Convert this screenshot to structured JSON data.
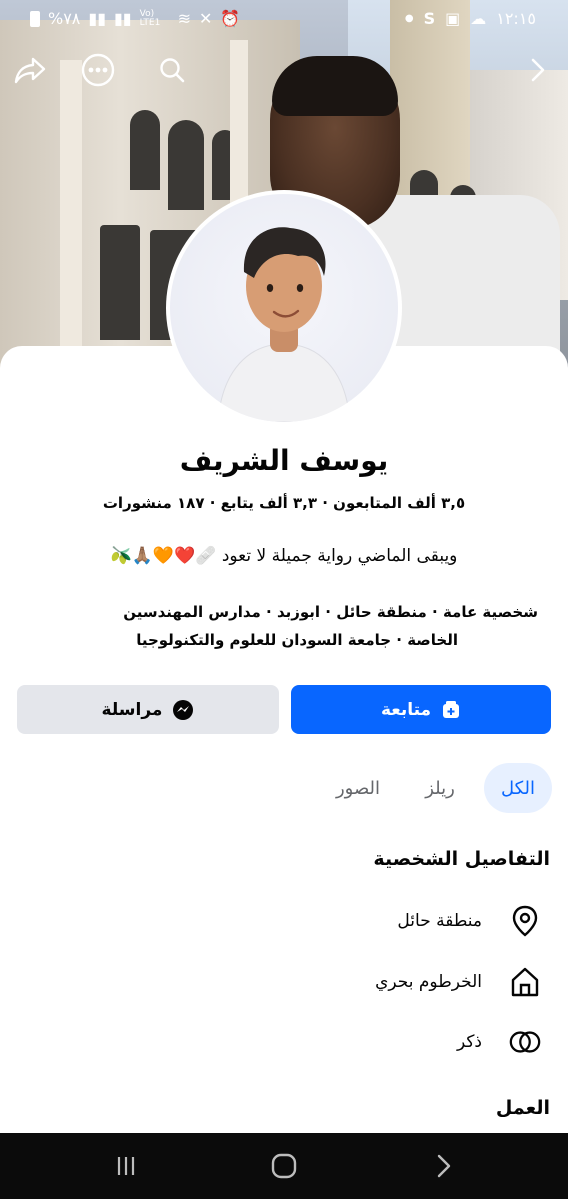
{
  "status_bar": {
    "time": "١٢:١٥",
    "battery": "%٧٨",
    "network": "Vo) LTE1"
  },
  "profile": {
    "name": "يوسف الشريف",
    "stats": "٣,٥ ألف المتابعون · ٣,٣ ألف يتابع · ١٨٧ منشورات",
    "bio": "ويبقى الماضي رواية جميلة لا تعود 🩹❤️🧡🙏🏽🫒",
    "meta_line1": "شخصية عامة · منطقة حائل · ابوزبد · مدارس المهندسين",
    "meta_line2": "الخاصة · جامعة السودان للعلوم والتكنولوجيا"
  },
  "buttons": {
    "follow": "متابعة",
    "message": "مراسلة"
  },
  "tabs": {
    "all": "الكل",
    "reels": "ريلز",
    "photos": "الصور"
  },
  "details": {
    "title": "التفاصيل الشخصية",
    "location": "منطقة حائل",
    "hometown": "الخرطوم بحري",
    "gender": "ذكر"
  },
  "work": {
    "title": "العمل"
  },
  "colors": {
    "primary": "#0866ff",
    "secondary_button": "#e4e6eb",
    "tab_active_bg": "#e7f0ff"
  }
}
